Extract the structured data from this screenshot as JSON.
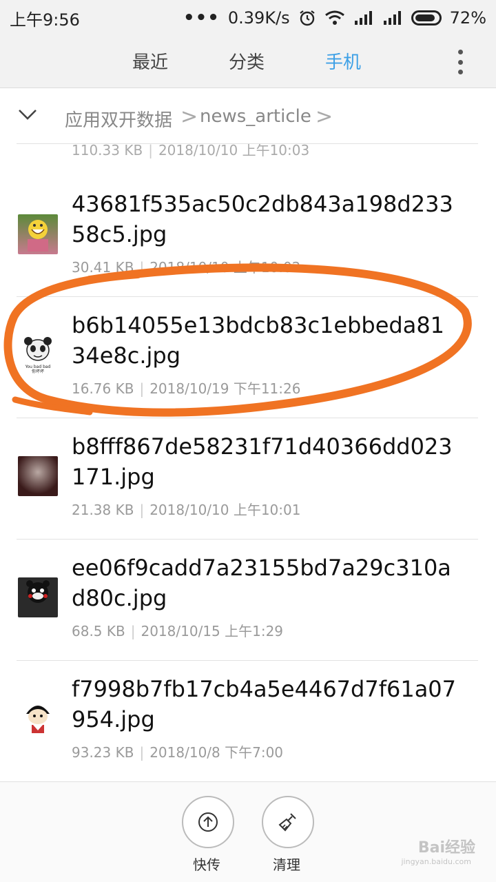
{
  "status_bar": {
    "time": "上午9:56",
    "dots": "•••",
    "speed": "0.39K/s",
    "battery": "72%"
  },
  "tabs": [
    {
      "label": "最近",
      "active": false
    },
    {
      "label": "分类",
      "active": false
    },
    {
      "label": "手机",
      "active": true
    }
  ],
  "breadcrumb": {
    "items": [
      "应用双开数据",
      "news_article"
    ],
    "separator": ">"
  },
  "partial_item": {
    "size": "110.33 KB",
    "date": "2018/10/10 上午10:03"
  },
  "files": [
    {
      "name": "43681f535ac50c2db843a198d23358c5.jpg",
      "size": "30.41 KB",
      "date": "2018/10/10 上午10:02",
      "thumb_icon": "laughing-character-thumbnail"
    },
    {
      "name": "b6b14055e13bdcb83c1ebbeda8134e8c.jpg",
      "size": "16.76 KB",
      "date": "2018/10/19 下午11:26",
      "thumb_icon": "panda-meme-thumbnail",
      "thumb_caption": "You bad bad\n你坏坏"
    },
    {
      "name": "b8fff867de58231f71d40366dd023171.jpg",
      "size": "21.38 KB",
      "date": "2018/10/10 上午10:01",
      "thumb_icon": "dark-photo-thumbnail"
    },
    {
      "name": "ee06f9cadd7a23155bd7a29c310ad80c.jpg",
      "size": "68.5 KB",
      "date": "2018/10/15 上午1:29",
      "thumb_icon": "bear-meme-thumbnail"
    },
    {
      "name": "f7998b7fb17cb4a5e4467d7f61a07954.jpg",
      "size": "93.23 KB",
      "date": "2018/10/8 下午7:00",
      "thumb_icon": "cartoon-meme-thumbnail"
    }
  ],
  "bottom_toolbar": {
    "send_label": "快传",
    "clean_label": "清理"
  },
  "watermark": {
    "text": "Bai经验",
    "url": "jingyan.baidu.com"
  },
  "colors": {
    "accent": "#3da0e6",
    "annotation": "#f07323"
  }
}
